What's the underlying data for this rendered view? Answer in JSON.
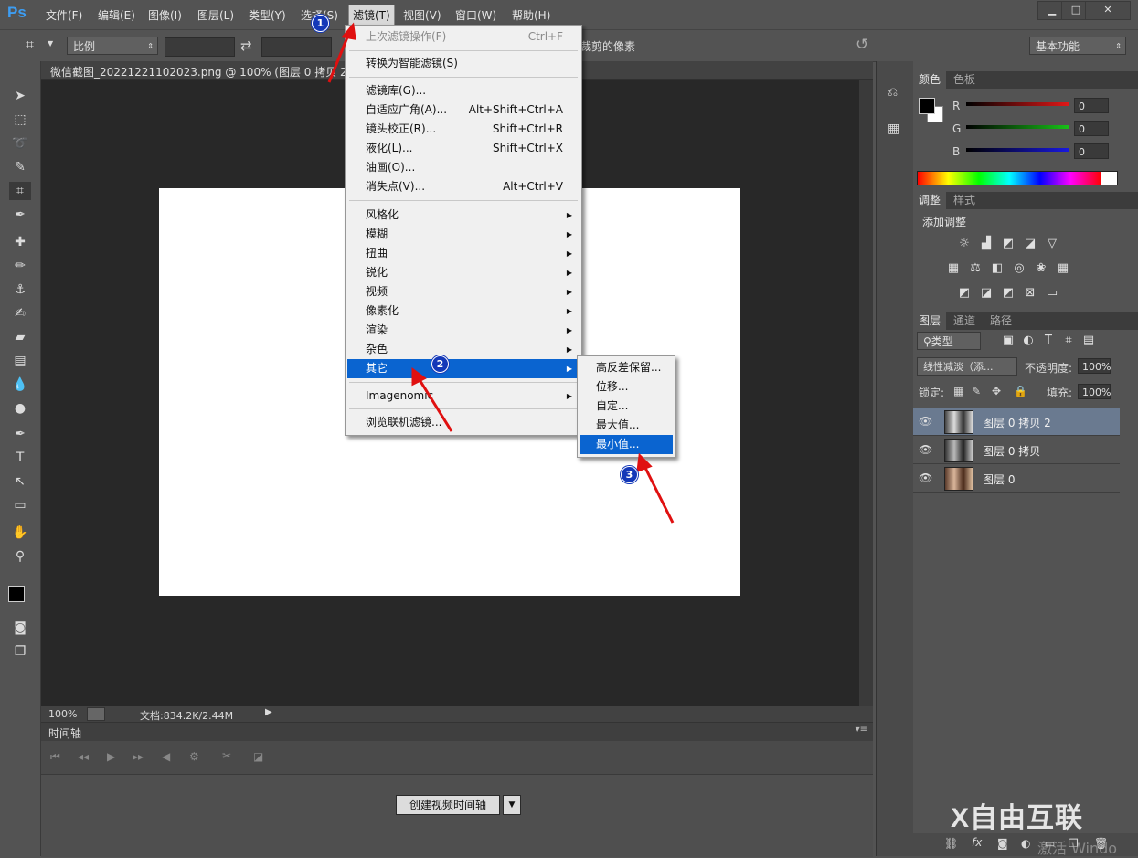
{
  "app": {
    "logo": "Ps"
  },
  "menubar": {
    "items": [
      "文件(F)",
      "编辑(E)",
      "图像(I)",
      "图层(L)",
      "类型(Y)",
      "选择(S)",
      "滤镜(T)",
      "视图(V)",
      "窗口(W)",
      "帮助(H)"
    ],
    "active": "滤镜(T)"
  },
  "window_controls": {
    "minimize": "▁",
    "maximize": "□",
    "close": "✕"
  },
  "options": {
    "ratio": "比例",
    "swap_icon": "⇄",
    "trim_text": "裁剪的像素",
    "workspace": "基本功能"
  },
  "document": {
    "tab_title": "微信截图_20221221102023.png @ 100% (图层 0 拷贝 2, RG",
    "zoom": "100%",
    "doc_size": "文档:834.2K/2.44M"
  },
  "timeline": {
    "title": "时间轴",
    "create_button": "创建视频时间轴"
  },
  "color_panel": {
    "tabs": [
      "颜色",
      "色板"
    ],
    "channels": [
      {
        "label": "R",
        "value": "0",
        "color": "#e01818"
      },
      {
        "label": "G",
        "value": "0",
        "color": "#18c018"
      },
      {
        "label": "B",
        "value": "0",
        "color": "#1818e0"
      }
    ]
  },
  "adjust_panel": {
    "tabs": [
      "调整",
      "样式"
    ],
    "title": "添加调整"
  },
  "layers_panel": {
    "tabs": [
      "图层",
      "通道",
      "路径"
    ],
    "filter": "类型",
    "blend_mode": "线性减淡（添...",
    "opacity_label": "不透明度:",
    "opacity": "100%",
    "lock_label": "锁定:",
    "fill_label": "填充:",
    "fill": "100%",
    "layers": [
      {
        "name": "图层 0 拷贝 2",
        "selected": true
      },
      {
        "name": "图层 0 拷贝",
        "selected": false
      },
      {
        "name": "图层 0",
        "selected": false
      }
    ]
  },
  "filter_menu": {
    "items": [
      {
        "label": "上次滤镜操作(F)",
        "shortcut": "Ctrl+F",
        "disabled": true
      },
      {
        "label": "转换为智能滤镜(S)",
        "shortcut": ""
      },
      {
        "label": "滤镜库(G)...",
        "shortcut": ""
      },
      {
        "label": "自适应广角(A)...",
        "shortcut": "Alt+Shift+Ctrl+A"
      },
      {
        "label": "镜头校正(R)...",
        "shortcut": "Shift+Ctrl+R"
      },
      {
        "label": "液化(L)...",
        "shortcut": "Shift+Ctrl+X"
      },
      {
        "label": "油画(O)...",
        "shortcut": ""
      },
      {
        "label": "消失点(V)...",
        "shortcut": "Alt+Ctrl+V"
      },
      {
        "label": "风格化"
      },
      {
        "label": "模糊"
      },
      {
        "label": "扭曲"
      },
      {
        "label": "锐化"
      },
      {
        "label": "视频"
      },
      {
        "label": "像素化"
      },
      {
        "label": "渲染"
      },
      {
        "label": "杂色"
      },
      {
        "label": "其它"
      },
      {
        "label": "Imagenomic"
      },
      {
        "label": "浏览联机滤镜..."
      }
    ]
  },
  "other_submenu": {
    "items": [
      "高反差保留...",
      "位移...",
      "自定...",
      "最大值...",
      "最小值..."
    ],
    "highlighted": "最小值..."
  },
  "annotations": {
    "step1": "1",
    "step2": "2",
    "step3": "3"
  },
  "watermark": {
    "text": "X自由互联",
    "sub": "激活 Windo"
  }
}
